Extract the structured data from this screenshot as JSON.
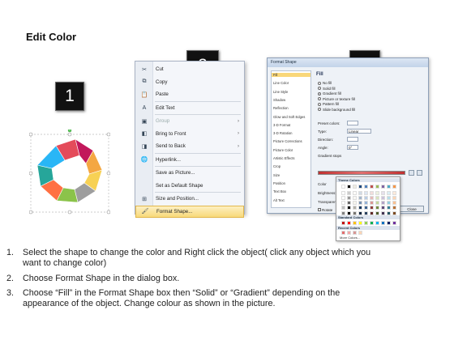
{
  "title": "Edit Color",
  "badges": {
    "one": "1",
    "two": "2",
    "three": "3"
  },
  "context_menu": {
    "items": [
      {
        "label": "Cut",
        "icon": "cut-icon",
        "glyph": "✂",
        "disabled": false,
        "submenu": false
      },
      {
        "label": "Copy",
        "icon": "copy-icon",
        "glyph": "⧉",
        "disabled": false,
        "submenu": false
      },
      {
        "label": "Paste",
        "icon": "paste-icon",
        "glyph": "📋",
        "disabled": false,
        "submenu": false
      },
      {
        "label": "Edit Text",
        "icon": "edit-text-icon",
        "glyph": "A",
        "disabled": false,
        "submenu": false
      },
      {
        "label": "Group",
        "icon": "group-icon",
        "glyph": "▣",
        "disabled": true,
        "submenu": true
      },
      {
        "label": "Bring to Front",
        "icon": "bring-front-icon",
        "glyph": "◧",
        "disabled": false,
        "submenu": true
      },
      {
        "label": "Send to Back",
        "icon": "send-back-icon",
        "glyph": "◨",
        "disabled": false,
        "submenu": true
      },
      {
        "label": "Hyperlink...",
        "icon": "hyperlink-icon",
        "glyph": "🌐",
        "disabled": false,
        "submenu": false
      },
      {
        "label": "Save as Picture...",
        "icon": "",
        "glyph": "",
        "disabled": false,
        "submenu": false
      },
      {
        "label": "Set as Default Shape",
        "icon": "",
        "glyph": "",
        "disabled": false,
        "submenu": false
      },
      {
        "label": "Size and Position...",
        "icon": "size-position-icon",
        "glyph": "⊞",
        "disabled": false,
        "submenu": false
      },
      {
        "label": "Format Shape...",
        "icon": "format-shape-icon",
        "glyph": "🖌",
        "disabled": false,
        "submenu": false
      }
    ]
  },
  "format_dialog": {
    "title": "Format Shape",
    "nav": [
      "Fill",
      "Line Color",
      "Line Style",
      "Shadow",
      "Reflection",
      "Glow and Soft Edges",
      "3-D Format",
      "3-D Rotation",
      "Picture Corrections",
      "Picture Color",
      "Artistic Effects",
      "Crop",
      "Size",
      "Position",
      "Text Box",
      "Alt Text"
    ],
    "section": "Fill",
    "fill_options": [
      "No fill",
      "Solid fill",
      "Gradient fill",
      "Picture or texture fill",
      "Pattern fill",
      "Slide background fill"
    ],
    "selected_fill": "Gradient fill",
    "fields": {
      "preset": "Preset colors:",
      "type_label": "Type:",
      "type_value": "Linear",
      "direction": "Direction:",
      "angle_label": "Angle:",
      "angle_value": "0°",
      "stops": "Gradient stops",
      "color": "Color",
      "position_label": "Position:",
      "position_value": "0%",
      "brightness": "Brightness:",
      "transparency": "Transparen",
      "rotate": "Rotate"
    },
    "close": "Close"
  },
  "palette": {
    "theme": "Theme Colors",
    "standard": "Standard Colors",
    "recent": "Recent Colors",
    "more": "More Colors...",
    "theme_cols": [
      "#ffffff",
      "#000000",
      "#eeece1",
      "#1f497d",
      "#4f81bd",
      "#c0504d",
      "#9bbb59",
      "#8064a2",
      "#4bacc6",
      "#f79646"
    ],
    "standard_cols": [
      "#c00000",
      "#ff0000",
      "#ffc000",
      "#ffff00",
      "#92d050",
      "#00b050",
      "#00b0f0",
      "#0070c0",
      "#002060",
      "#7030a0"
    ],
    "recent_cols": [
      "#e46c6c",
      "#f2a7a7",
      "#d99694",
      "#fbd5b5"
    ]
  },
  "instructions": [
    {
      "num": "1.",
      "lines": [
        "Select the shape to change the color and Right click the object( click any object which you",
        "want to change color)"
      ]
    },
    {
      "num": "2.",
      "lines": [
        "Choose Format Shape in the dialog box."
      ]
    },
    {
      "num": "3.",
      "lines": [
        "Choose “Fill” in the Format Shape box then “Solid” or “Gradient” depending on the",
        "appearance of the object. Change colour as shown in the picture."
      ]
    }
  ],
  "colors": {
    "highlight": "#f8d97a",
    "badge": "#111111"
  }
}
